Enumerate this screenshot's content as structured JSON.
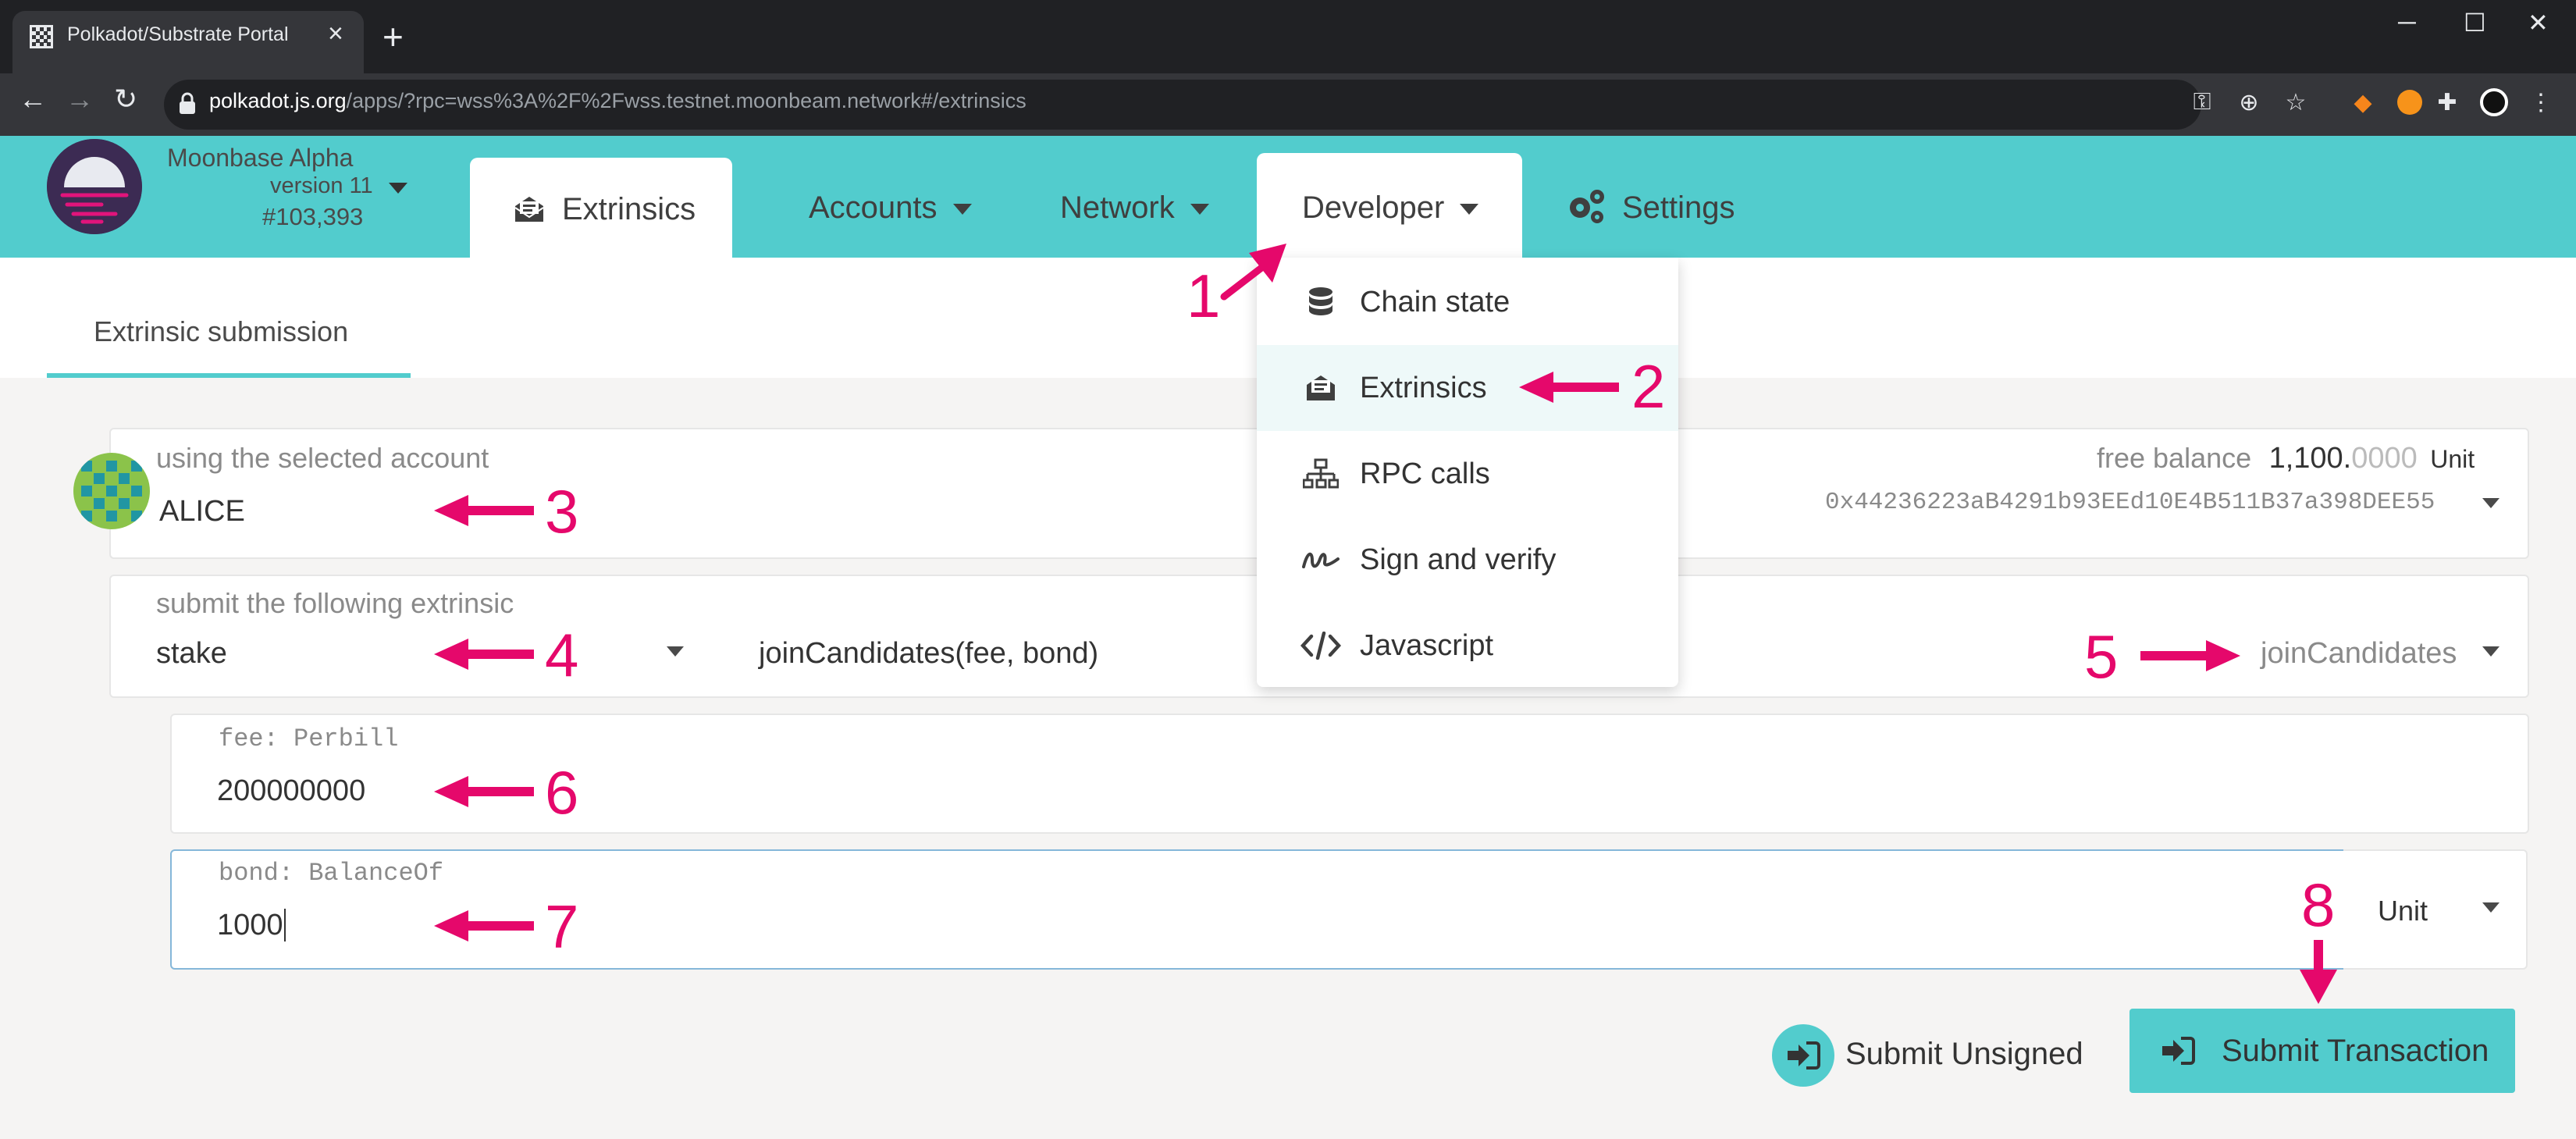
{
  "browser": {
    "tab_title": "Polkadot/Substrate Portal",
    "url_host": "polkadot.js.org",
    "url_rest": "/apps/?rpc=wss%3A%2F%2Fwss.testnet.moonbeam.network#/extrinsics"
  },
  "chain": {
    "name": "Moonbase Alpha",
    "version": "version 11",
    "block": "#103,393"
  },
  "menu": {
    "extrinsics": "Extrinsics",
    "accounts": "Accounts",
    "network": "Network",
    "developer": "Developer",
    "settings": "Settings"
  },
  "dropdown": {
    "items": [
      {
        "label": "Chain state",
        "icon": "database-icon"
      },
      {
        "label": "Extrinsics",
        "icon": "envelope-open-icon"
      },
      {
        "label": "RPC calls",
        "icon": "network-icon"
      },
      {
        "label": "Sign and verify",
        "icon": "signature-icon"
      },
      {
        "label": "Javascript",
        "icon": "code-icon"
      }
    ]
  },
  "subheader": {
    "tab": "Extrinsic submission"
  },
  "account": {
    "label": "using the selected account",
    "name": "ALICE",
    "free_balance_label": "free balance",
    "balance_int": "1,100.",
    "balance_dec": "0000",
    "balance_unit": "Unit",
    "address": "0x44236223aB4291b93EEd10E4B511B37a398DEE55"
  },
  "extrinsic": {
    "label": "submit the following extrinsic",
    "module": "stake",
    "call_signature": "joinCandidates(fee, bond)",
    "call": "joinCandidates"
  },
  "params": {
    "fee_label": "fee: Perbill",
    "fee_value": "200000000",
    "bond_label": "bond: BalanceOf",
    "bond_value": "1000",
    "bond_unit": "Unit"
  },
  "buttons": {
    "submit_unsigned": "Submit Unsigned",
    "submit_transaction": "Submit Transaction"
  },
  "annotations": [
    "1",
    "2",
    "3",
    "4",
    "5",
    "6",
    "7",
    "8"
  ],
  "colors": {
    "accent": "#52cccd",
    "annotation": "#e5086b",
    "selected_row": "#eef9f9"
  }
}
